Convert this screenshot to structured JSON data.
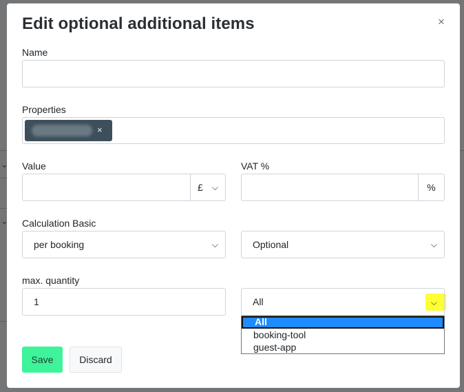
{
  "modal": {
    "title": "Edit optional additional items",
    "close_icon": "close-icon"
  },
  "form": {
    "name": {
      "label": "Name",
      "value": ""
    },
    "properties": {
      "label": "Properties",
      "tag_remove": "×"
    },
    "value": {
      "label": "Value",
      "value": "",
      "currency": "£"
    },
    "vat": {
      "label": "VAT %",
      "value": "",
      "suffix": "%"
    },
    "calculation": {
      "label": "Calculation Basic",
      "basis": "per booking",
      "type": "Optional"
    },
    "max_quantity": {
      "label": "max. quantity",
      "value": "1"
    },
    "channel": {
      "selected": "All",
      "options": [
        "All",
        "booking-tool",
        "guest-app"
      ]
    }
  },
  "buttons": {
    "save": "Save",
    "discard": "Discard"
  },
  "colors": {
    "primary": "#3ff39b",
    "tag": "#3e4f5c",
    "option_selected": "#1e8cff",
    "highlight": "#ffff33"
  }
}
